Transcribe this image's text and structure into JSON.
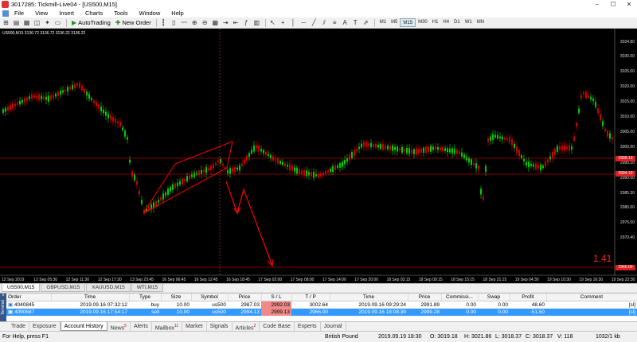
{
  "window": {
    "title": "3017285: Tickmill-Live04 - [US500,M15]"
  },
  "menu": [
    "File",
    "View",
    "Insert",
    "Charts",
    "Tools",
    "Window",
    "Help"
  ],
  "toolbar": {
    "autotrading_label": "AutoTrading",
    "new_order_label": "New Order",
    "timeframes": [
      "M1",
      "M5",
      "M15",
      "M30",
      "H1",
      "H4",
      "D1",
      "W1",
      "MN"
    ],
    "active_timeframe": "M15"
  },
  "chart": {
    "header": "US500,M15  3136.72 3136.72 3136.22 3136.22",
    "price_labels": [
      "3034.80",
      "3030.00",
      "3025.00",
      "3020.00",
      "3015.00",
      "3010.00",
      "3005.00",
      "3000.00",
      "2995.20",
      "2990.00",
      "2985.30",
      "2980.00",
      "2975.00",
      "2970.40"
    ],
    "time_labels": [
      "12 Sep 2019",
      "12 Sep 05:30",
      "12 Sep 11:30",
      "12 Sep 17:30",
      "13 Sep 23:45",
      "16 Sep 06:45",
      "16 Sep 12:45",
      "16 Sep 18:45",
      "17 Sep 02:00",
      "17 Sep 08:00",
      "17 Sep 14:00",
      "17 Sep 20:00",
      "18 Sep 03:15",
      "18 Sep 09:15",
      "18 Sep 15:15",
      "18 Sep 21:15",
      "19 Sep 04:30",
      "19 Sep 10:30",
      "19 Sep 16:30",
      "19 Sep 22:30"
    ],
    "profit_readout": "1.41",
    "line_tags": {
      "upper": "2999.13",
      "lower": "2994.19",
      "target": "2966.00"
    },
    "colors": {
      "bull": "#00cc00",
      "bear": "#cc0000",
      "channel": "#ff0000",
      "crosshair": "#cc2222"
    }
  },
  "symbol_tabs": [
    "US500,M15",
    "GBPUSD,M15",
    "XAUUSD,M15",
    "WTI,M15"
  ],
  "active_symbol_tab": "US500,M15",
  "terminal": {
    "side_label": "Terminal",
    "columns": [
      "Order",
      "Time",
      "Type",
      "Size",
      "Symbol",
      "Price",
      "S / L",
      "T / P",
      "Time",
      "Price",
      "Commissi...",
      "Swap",
      "Profit",
      "Comment"
    ],
    "rows": [
      {
        "order": "4040845",
        "time": "2019.09.16 07:32:12",
        "type": "buy",
        "size": "10.00",
        "symbol": "us500",
        "price": "2987.03",
        "sl": "2992.03",
        "tp": "3002.64",
        "close_time": "2019.09.16 09:29:24",
        "close_price": "2991.89",
        "commission": "0.00",
        "swap": "0.00",
        "profit": "48.60",
        "comment": "[sl]"
      },
      {
        "order": "4090687",
        "time": "2019.09.16 17:54:17",
        "type": "sell",
        "size": "10.00",
        "symbol": "us500",
        "price": "2994.13",
        "sl": "2999.13",
        "tp": "2966.00",
        "close_time": "2019.09.16 18:08:39",
        "close_price": "2999.28",
        "commission": "0.00",
        "swap": "0.00",
        "profit": "-51.50",
        "comment": "[sl]"
      }
    ]
  },
  "bottom_tabs": [
    {
      "label": "Trade",
      "badge": ""
    },
    {
      "label": "Exposure",
      "badge": ""
    },
    {
      "label": "Account History",
      "badge": ""
    },
    {
      "label": "News",
      "badge": "5"
    },
    {
      "label": "Alerts",
      "badge": ""
    },
    {
      "label": "Mailbox",
      "badge": "11"
    },
    {
      "label": "Market",
      "badge": ""
    },
    {
      "label": "Signals",
      "badge": ""
    },
    {
      "label": "Articles",
      "badge": "2"
    },
    {
      "label": "Code Base",
      "badge": ""
    },
    {
      "label": "Experts",
      "badge": ""
    },
    {
      "label": "Journal",
      "badge": ""
    }
  ],
  "active_bottom_tab": "Account History",
  "status": {
    "help": "For Help, press F1",
    "profile": "British Pound",
    "datetime": "2019.09.19 18:30",
    "open": "O: 3019.18",
    "high": "H: 3021.86",
    "low": "L: 3018.37",
    "close": "C: 3018.37",
    "volume": "V: 118",
    "traffic": "1032/1 kb"
  }
}
